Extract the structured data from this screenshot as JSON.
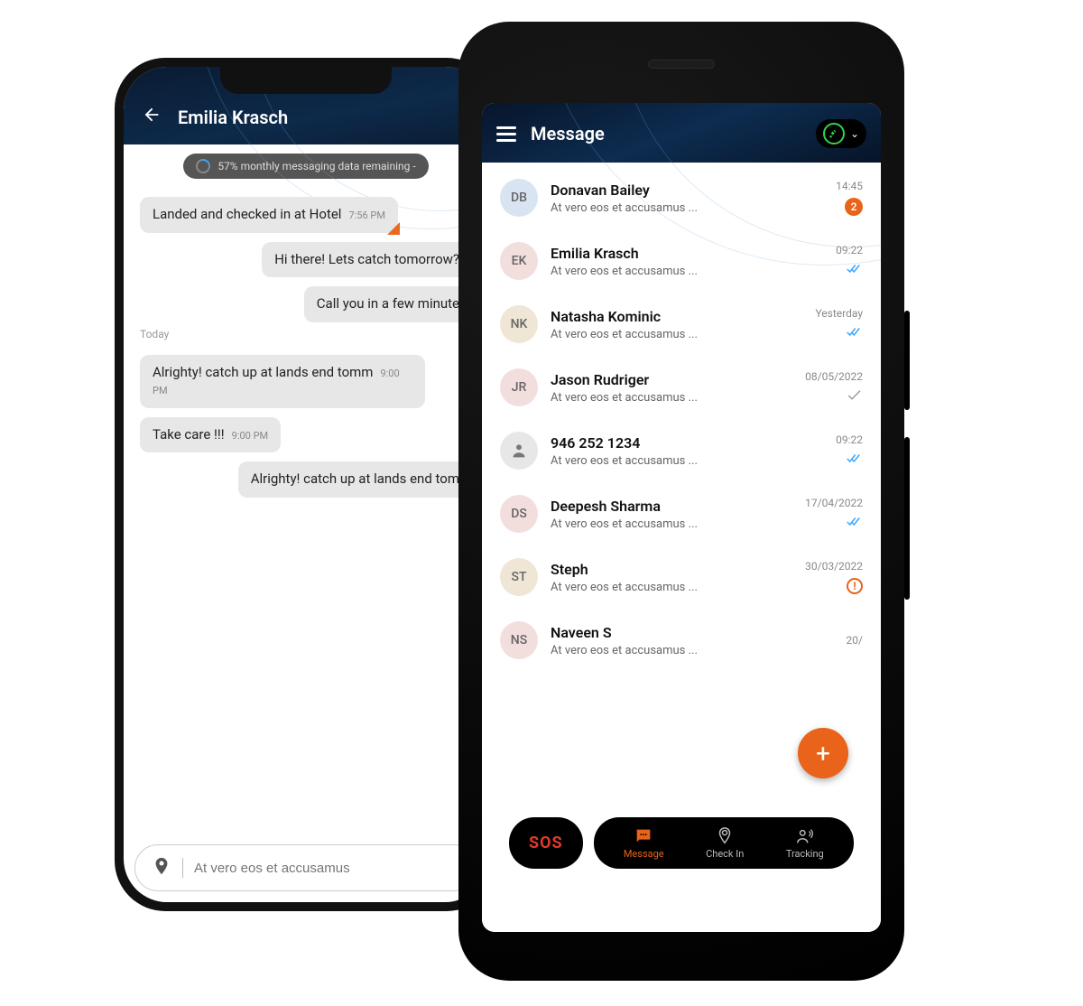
{
  "chat": {
    "header_title": "Emilia Krasch",
    "data_remaining": "57% monthly messaging data remaining -",
    "day_sep": "Today",
    "composer_placeholder": "At vero eos et accusamus",
    "messages": [
      {
        "side": "left",
        "text": "Landed and checked in at Hotel",
        "time": "7:56 PM",
        "corner": true
      },
      {
        "side": "right",
        "text": "Hi there! Lets catch tomorrow?",
        "time": ""
      },
      {
        "side": "right",
        "text": "Call you in a few minute",
        "time": ""
      },
      {
        "side": "left",
        "text": "Alrighty! catch up at lands end tomm",
        "time": "9:00 PM"
      },
      {
        "side": "left",
        "text": "Take care !!!",
        "time": "9:00 PM"
      },
      {
        "side": "right",
        "text": "Alrighty! catch up at lands end tom",
        "time": ""
      }
    ]
  },
  "list": {
    "header_title": "Message",
    "nav": {
      "sos": "SOS",
      "message": "Message",
      "checkin": "Check In",
      "tracking": "Tracking"
    },
    "fab": "+",
    "conversations": [
      {
        "initials": "DB",
        "color": "#d8e4f2",
        "name": "Donavan Bailey",
        "preview": "At vero eos et accusamus ...",
        "time": "14:45",
        "status": "badge",
        "badge": "2"
      },
      {
        "initials": "EK",
        "color": "#f3dede",
        "name": "Emilia Krasch",
        "preview": "At vero eos et accusamus ...",
        "time": "09:22",
        "status": "read"
      },
      {
        "initials": "NK",
        "color": "#efe6d6",
        "name": "Natasha Kominic",
        "preview": "At vero eos et accusamus ...",
        "time": "Yesterday",
        "status": "read"
      },
      {
        "initials": "JR",
        "color": "#f3dede",
        "name": "Jason Rudriger",
        "preview": "At vero eos et accusamus ...",
        "time": "08/05/2022",
        "status": "sent"
      },
      {
        "initials": "",
        "color": "#e7e7e7",
        "name": "946 252 1234",
        "preview": "At vero eos et accusamus ...",
        "time": "09:22",
        "status": "read",
        "person_icon": true
      },
      {
        "initials": "DS",
        "color": "#f3dede",
        "name": "Deepesh Sharma",
        "preview": "At vero eos et accusamus ...",
        "time": "17/04/2022",
        "status": "read"
      },
      {
        "initials": "ST",
        "color": "#efe6d6",
        "name": "Steph",
        "preview": "At vero eos et accusamus ...",
        "time": "30/03/2022",
        "status": "warn"
      },
      {
        "initials": "NS",
        "color": "#f3dede",
        "name": "Naveen S",
        "preview": "At vero eos et accusamus ...",
        "time": "20/",
        "status": "none"
      }
    ]
  }
}
